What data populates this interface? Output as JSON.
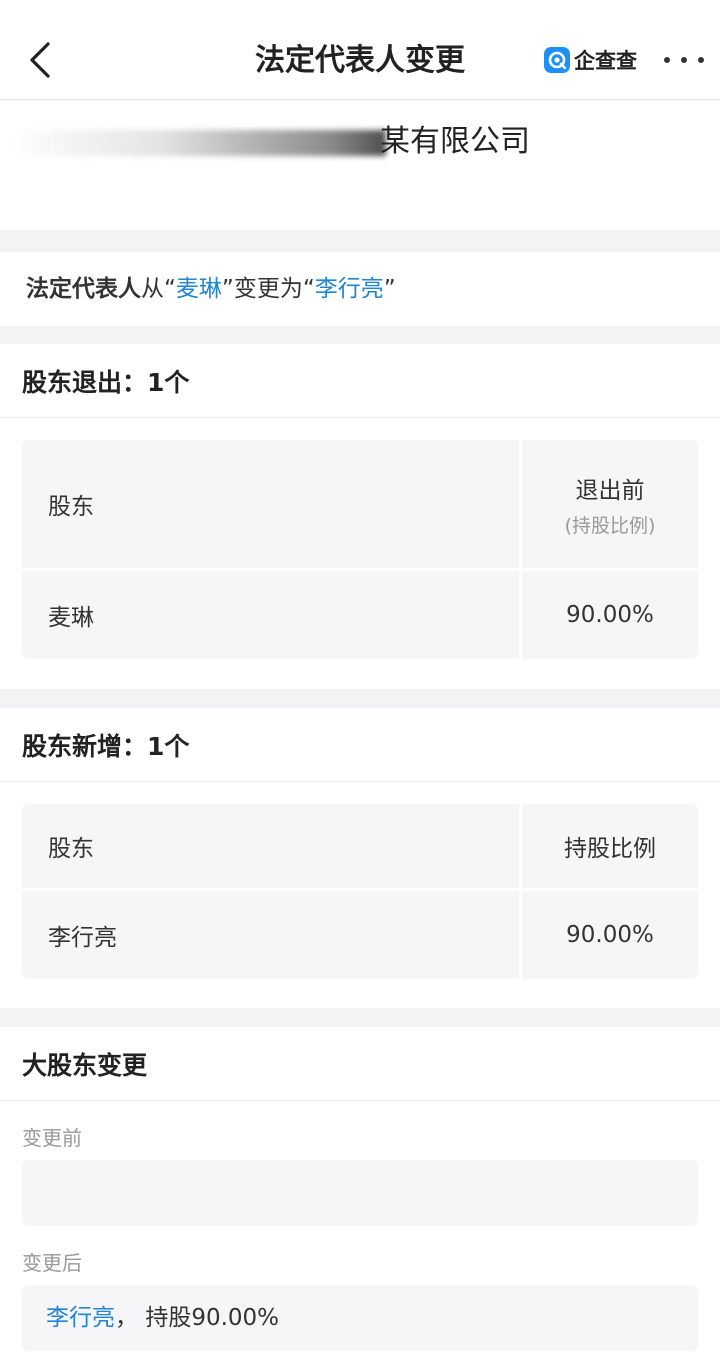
{
  "nav": {
    "title": "法定代表人变更",
    "brand": "企查查"
  },
  "company": {
    "name_visible": "某有限公司"
  },
  "summary": {
    "label": "法定代表人",
    "from_word": "从",
    "open_quote": "“",
    "close_quote": "”",
    "old_name": "麦琳",
    "to_word": "变更为",
    "new_name": "李行亮"
  },
  "exit": {
    "heading": "股东退出：1个",
    "col1": "股东",
    "col2": "退出前",
    "col2_sub": "(持股比例)",
    "rows": [
      {
        "name": "麦琳",
        "value": "90.00%"
      }
    ]
  },
  "add": {
    "heading": "股东新增：1个",
    "col1": "股东",
    "col2": "持股比例",
    "rows": [
      {
        "name": "李行亮",
        "value": "90.00%"
      }
    ]
  },
  "major": {
    "heading": "大股东变更",
    "before_label": "变更前",
    "after_label": "变更后",
    "after_name": "李行亮",
    "after_sep": "，",
    "after_text": "持股90.00%"
  }
}
